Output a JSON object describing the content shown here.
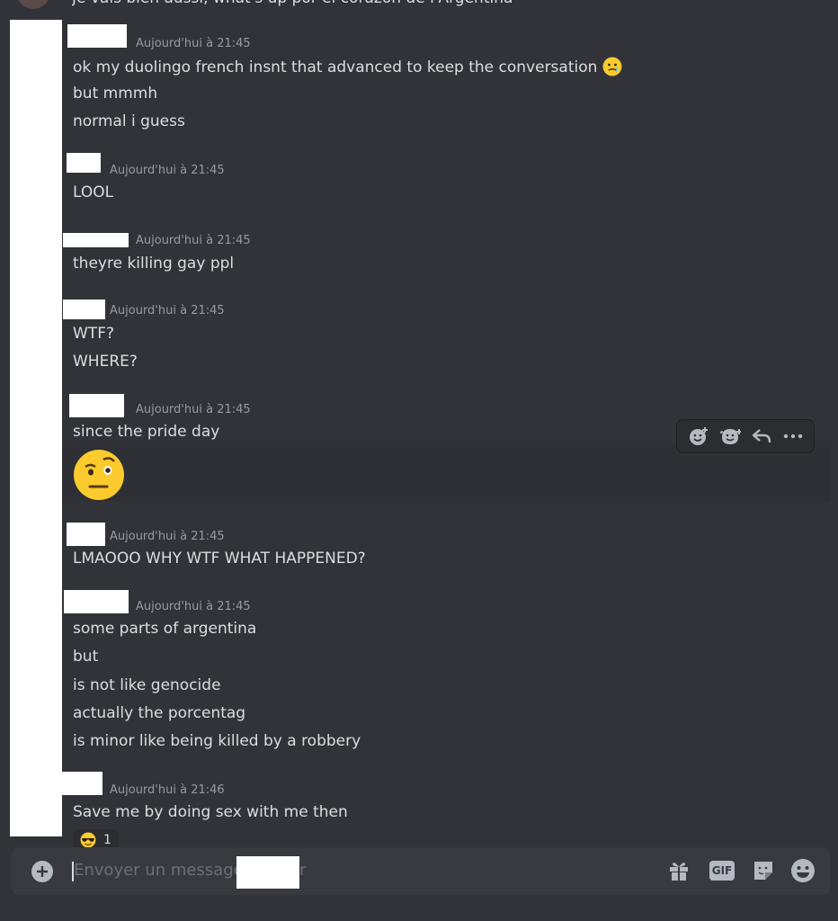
{
  "top_partial": {
    "text": "Je vais bien aussi, what's up por el corazon de l'Argentina"
  },
  "messages": [
    {
      "time": "Aujourd'hui à 21:45",
      "lines": [
        "ok my duolingo french insnt that advanced to keep the conversation",
        "but mmmh",
        "normal i guess"
      ]
    },
    {
      "time": "Aujourd'hui à 21:45",
      "lines": [
        "LOOL"
      ]
    },
    {
      "time": "Aujourd'hui à 21:45",
      "lines": [
        "theyre killing gay ppl"
      ]
    },
    {
      "time": "Aujourd'hui à 21:45",
      "lines": [
        "WTF?",
        "WHERE?"
      ]
    },
    {
      "time": "Aujourd'hui à 21:45",
      "lines": [
        "since the pride day"
      ]
    },
    {
      "time": "Aujourd'hui à 21:45",
      "lines": [
        "LMAOOO WHY WTF WHAT HAPPENED?"
      ]
    },
    {
      "time": "Aujourd'hui à 21:45",
      "lines": [
        "some parts of argentina",
        "but",
        "is not like genocide",
        "actually the porcentag",
        "is minor like being killed by a robbery"
      ]
    },
    {
      "time": "Aujourd'hui à 21:46",
      "lines": [
        "Save me by doing sex with me then"
      ]
    }
  ],
  "reaction": {
    "emoji": "sunglasses-emoji",
    "count": "1"
  },
  "toolbar": {
    "icons": [
      "add-reaction-icon",
      "super-reaction-icon",
      "reply-icon",
      "more-icon"
    ]
  },
  "composer": {
    "placeholder": "Envoyer un message à",
    "placeholder_tail": "r",
    "gif_label": "GIF"
  },
  "colors": {
    "background": "#313338",
    "text": "#dbdee1",
    "muted": "#949ba4",
    "composer": "#383a40"
  }
}
